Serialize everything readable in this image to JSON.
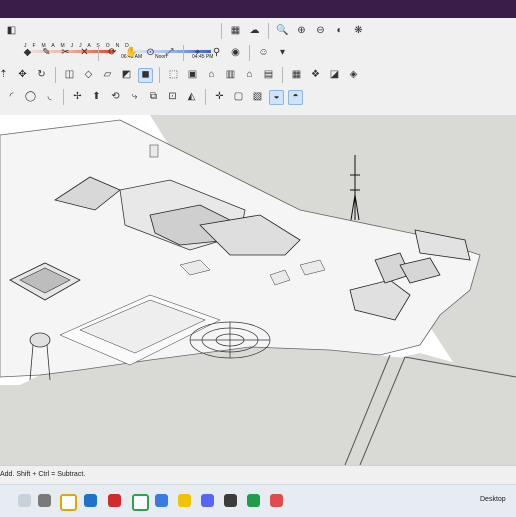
{
  "shadow_settings": {
    "months": "J F M A M J J A S O N D",
    "time_start": "06:43 AM",
    "time_noon": "Noon",
    "time_end": "04:45 PM"
  },
  "status": {
    "hint": "Add. Shift + Ctrl = Subtract."
  },
  "taskbar": {
    "desktop_label": "Desktop"
  },
  "colors": {
    "title_bar": "#3b1d49",
    "ground": "#d9d9d6",
    "selection": "#cfe4f7"
  }
}
